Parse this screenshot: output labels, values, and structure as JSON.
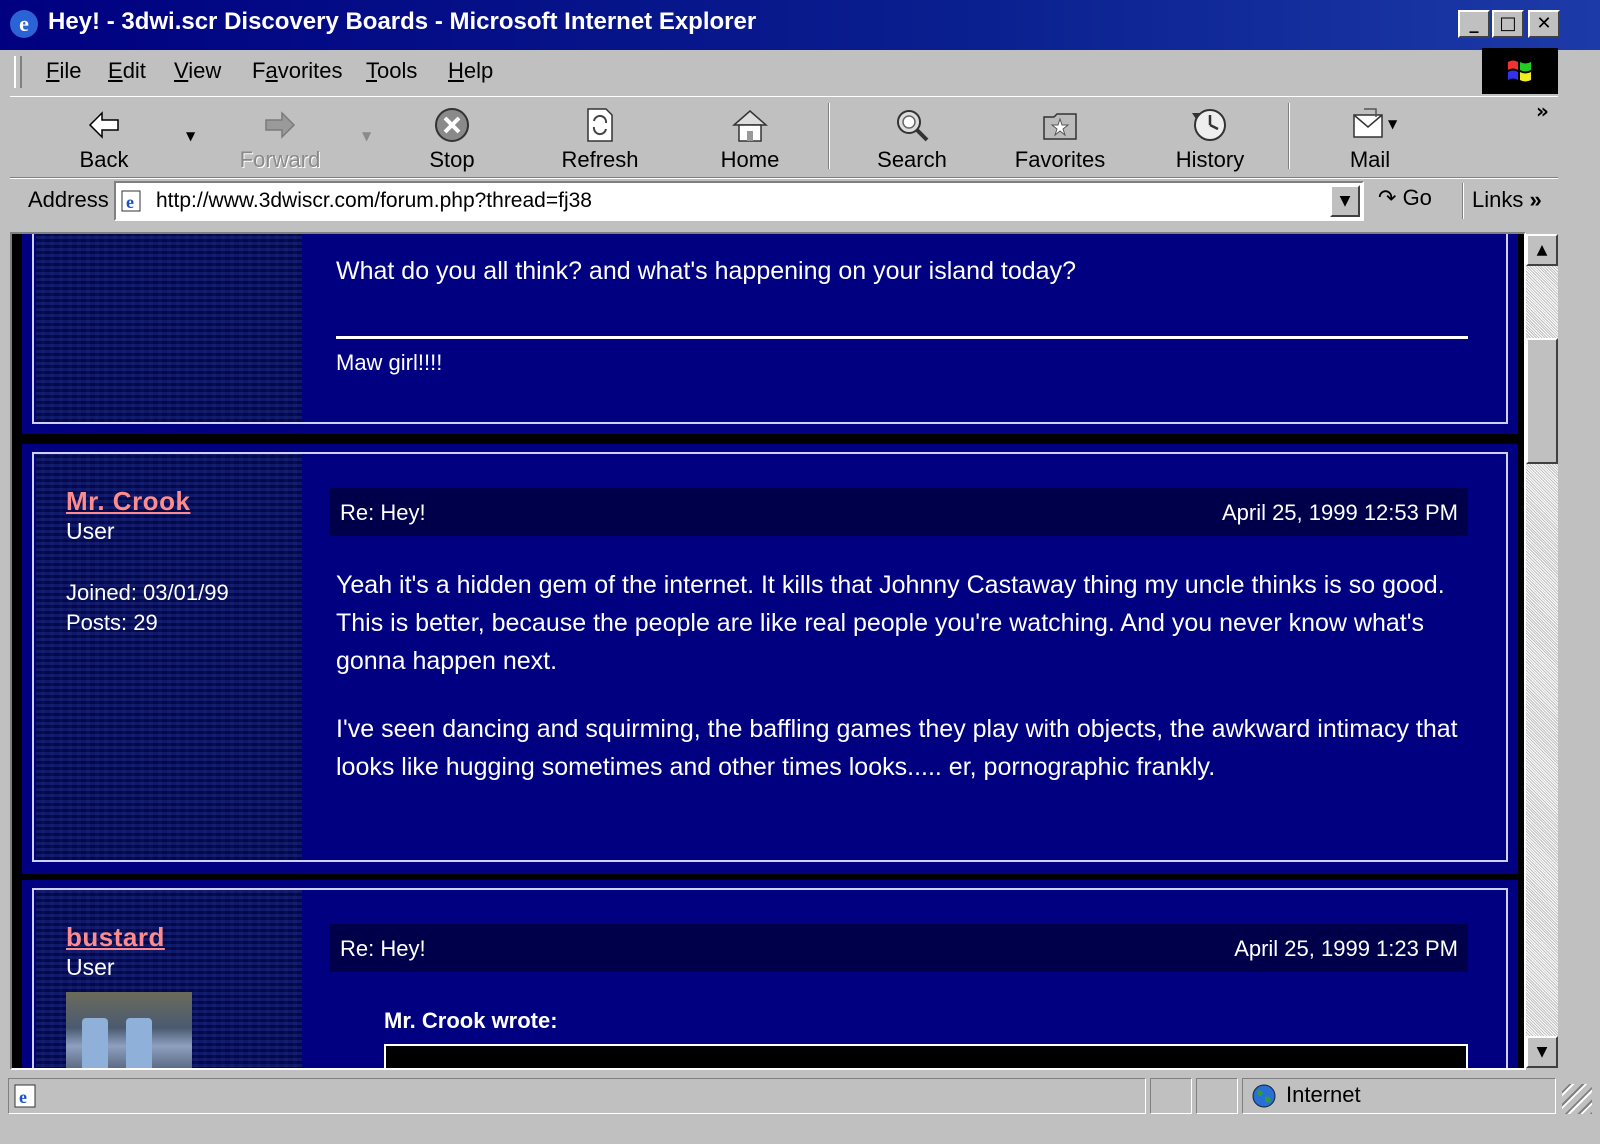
{
  "window": {
    "title": "Hey! - 3dwi.scr Discovery Boards - Microsoft Internet Explorer",
    "controls": [
      "_",
      "□",
      "✕"
    ]
  },
  "menu": [
    {
      "label": "File",
      "accel": "F",
      "rest": "ile"
    },
    {
      "label": "Edit",
      "accel": "E",
      "rest": "dit"
    },
    {
      "label": "View",
      "accel": "V",
      "rest": "iew"
    },
    {
      "label": "Favorites",
      "accel": "a",
      "pre": "F",
      "rest": "vorites"
    },
    {
      "label": "Tools",
      "accel": "T",
      "rest": "ools"
    },
    {
      "label": "Help",
      "accel": "H",
      "rest": "elp"
    }
  ],
  "toolbar": {
    "back": "Back",
    "forward": "Forward",
    "stop": "Stop",
    "refresh": "Refresh",
    "home": "Home",
    "search": "Search",
    "favorites": "Favorites",
    "history": "History",
    "mail": "Mail",
    "chevron": "»"
  },
  "address": {
    "label": "Address",
    "url": "http://www.3dwiscr.com/forum.php?thread=fj38",
    "go": "Go",
    "links": "Links"
  },
  "posts": [
    {
      "body": "What do you all think? and what's happening on your island today?",
      "signature": "Maw girl!!!!"
    },
    {
      "author": "Mr. Crook",
      "role": "User",
      "joined": "Joined: 03/01/99",
      "posts": "Posts: 29",
      "subject": "Re: Hey!",
      "date": "April 25, 1999 12:53 PM",
      "paragraphs": [
        "Yeah it's a hidden gem of the internet. It kills that Johnny Castaway thing my uncle thinks is so good. This is better, because the people are like real people you're watching. And you never know what's gonna happen next.",
        "I've seen dancing and squirming, the baffling games they play with objects, the awkward intimacy that looks like hugging sometimes and other times looks..... er, pornographic frankly."
      ]
    },
    {
      "author": "bustard",
      "role": "User",
      "subject": "Re: Hey!",
      "date": "April 25, 1999 1:23 PM",
      "quote_label": "Mr. Crook wrote:"
    }
  ],
  "status": {
    "zone": "Internet"
  },
  "colors": {
    "titlebar": "#000080",
    "chrome": "#c0c0c0",
    "post_bg": "#000080",
    "username": "#ff8c8c",
    "subject_bar": "#00004a"
  }
}
